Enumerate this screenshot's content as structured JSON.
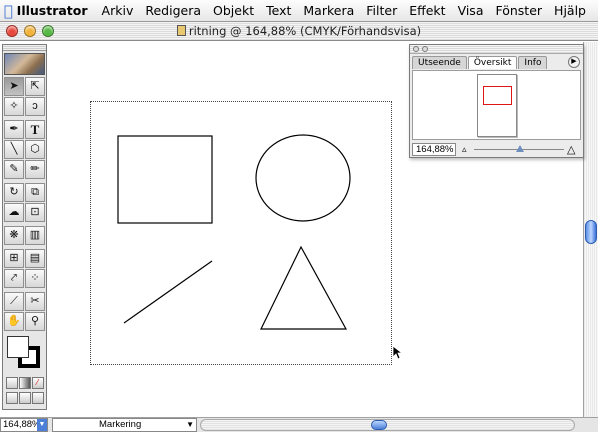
{
  "menubar": {
    "app_name": "Illustrator",
    "items": [
      "Arkiv",
      "Redigera",
      "Objekt",
      "Text",
      "Markera",
      "Filter",
      "Effekt",
      "Visa",
      "Fönster",
      "Hjälp"
    ]
  },
  "window": {
    "title": "ritning @ 164,88% (CMYK/Förhandsvisa)"
  },
  "status_bar": {
    "zoom": "164,88%",
    "info_menu": "Markering"
  },
  "navigator": {
    "tabs": [
      "Utseende",
      "Översikt",
      "Info"
    ],
    "active_tab": "Översikt",
    "zoom": "164,88%"
  },
  "artwork": {
    "shapes": [
      "square",
      "circle",
      "line",
      "triangle"
    ],
    "stroke_color": "#000000"
  },
  "tools": {
    "palette_icons": [
      "selection-arrow-icon",
      "direct-selection-icon",
      "magic-wand-icon",
      "lasso-icon",
      "pen-icon",
      "type-icon",
      "line-segment-icon",
      "ellipse-icon",
      "paintbrush-icon",
      "pencil-icon",
      "rotate-icon",
      "scale-icon",
      "warp-icon",
      "free-transform-icon",
      "symbol-sprayer-icon",
      "column-graph-icon",
      "mesh-icon",
      "gradient-icon",
      "eyedropper-icon",
      "blend-icon",
      "slice-icon",
      "scissors-icon",
      "hand-icon",
      "zoom-icon"
    ]
  },
  "colors": {
    "accent_blue": "#4c7fd8",
    "nav_proxy_red": "#e01515"
  }
}
